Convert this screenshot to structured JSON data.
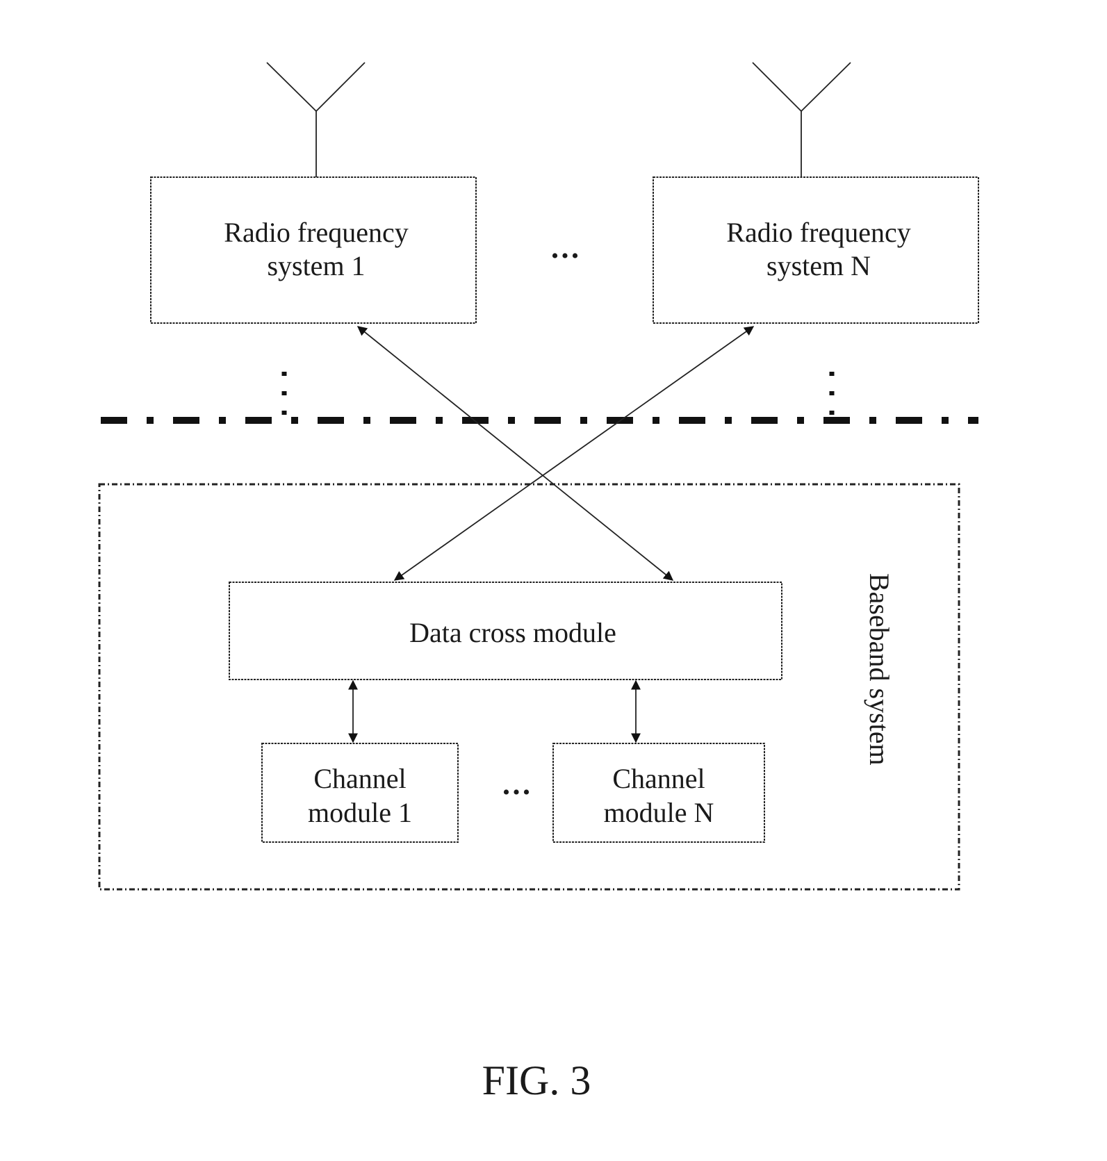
{
  "figure": {
    "caption": "FIG. 3",
    "rf_systems": [
      {
        "line1": "Radio frequency",
        "line2": "system 1"
      },
      {
        "line1": "Radio frequency",
        "line2": "system N"
      }
    ],
    "rf_ellipsis": "•••",
    "baseband": {
      "label": "Baseband system",
      "data_cross": "Data cross module",
      "channels": [
        {
          "line1": "Channel",
          "line2": "module 1"
        },
        {
          "line1": "Channel",
          "line2": "module N"
        }
      ],
      "channel_ellipsis": "•••"
    }
  }
}
